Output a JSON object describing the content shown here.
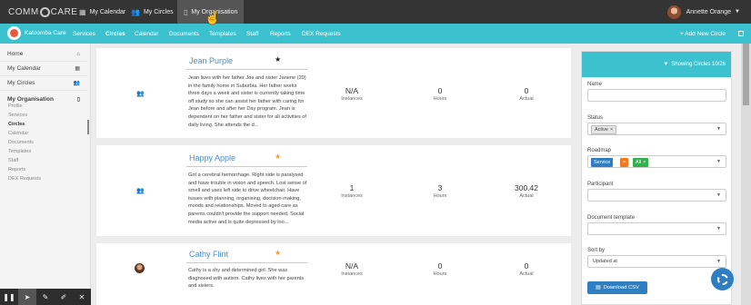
{
  "app": {
    "logo_text": "COMM CARE"
  },
  "topnav": {
    "items": [
      {
        "label": "My Calendar",
        "icon": "calendar-icon"
      },
      {
        "label": "My Circles",
        "icon": "group-icon",
        "has_caret": true
      },
      {
        "label": "My Organisation",
        "icon": "building-icon",
        "active": true
      }
    ],
    "user": {
      "name": "Annette Orange"
    }
  },
  "subnav": {
    "org_name": "Katoomba Care",
    "items": [
      "Services",
      "Circles",
      "Calendar",
      "Documents",
      "Templates",
      "Staff",
      "Reports",
      "DEX Requests"
    ],
    "active": "Circles",
    "add_label": "+ Add New Circle"
  },
  "sidebar": {
    "items": [
      {
        "label": "Home",
        "icon": "home-icon"
      },
      {
        "label": "My Calendar",
        "icon": "calendar-icon"
      },
      {
        "label": "My Circles",
        "icon": "group-icon"
      },
      {
        "label": "My Organisation",
        "icon": "building-icon"
      }
    ],
    "org_subitems": [
      "Profile",
      "Services",
      "Circles",
      "Calendar",
      "Documents",
      "Templates",
      "Staff",
      "Reports",
      "DEX Requests"
    ],
    "active_sub": "Circles"
  },
  "circles": [
    {
      "name": "Jean Purple",
      "starred": false,
      "avatar": "group-icon",
      "description": "Jean lives with her father Joe and sister Janene (20) in the family home in Suburbia. Her father works three days a week and sister is currently taking time off study so she can assist her father with caring for Jean before and after her Day program. Jean is dependent on her father and sister for all activities of daily living. She attends the d...",
      "instances": "N/A",
      "hours": "0",
      "actual": "0"
    },
    {
      "name": "Happy Apple",
      "starred": true,
      "avatar": "group-icon",
      "description": "Got a cerebral hemorrhage. Right side is paralysed and have trouble in vision and speech. Lost sense of smell and uses left side to drive wheelchair. Have issues with planning, organising, decision making, moods and relationships. Moved to aged care as parents couldn't provide the support needed. Social media active and is quite depressed by loo...",
      "instances": "1",
      "hours": "3",
      "actual": "300.42"
    },
    {
      "name": "Cathy Flint",
      "starred": true,
      "avatar": "photo",
      "description": "Cathy is a shy and determined girl. She was diagnosed with autism. Cathy lives with her parents and sisters.",
      "instances": "N/A",
      "hours": "0",
      "actual": "0"
    }
  ],
  "metric_labels": {
    "instances": "Instances",
    "hours": "Hours",
    "actual": "Actual"
  },
  "filter": {
    "header": "Showing Circles 10/26",
    "name_label": "Name",
    "name_value": "",
    "status_label": "Status",
    "status_chip": "Active",
    "roadmap_label": "Roadmap",
    "roadmap_chips": [
      "Service",
      "=",
      "All"
    ],
    "participant_label": "Participant",
    "document_template_label": "Document template",
    "sort_label": "Sort by",
    "sort_value": "Updated at",
    "csv_button": "Download CSV"
  },
  "colors": {
    "topbar": "#343434",
    "accent": "#3cc2cf",
    "link": "#4a90c8",
    "star": "#f0a020",
    "button": "#2f7ec1"
  },
  "toolbar": {
    "tools": [
      "pause-icon",
      "pointer-icon",
      "pen-icon",
      "marker-icon",
      "close-icon"
    ]
  }
}
